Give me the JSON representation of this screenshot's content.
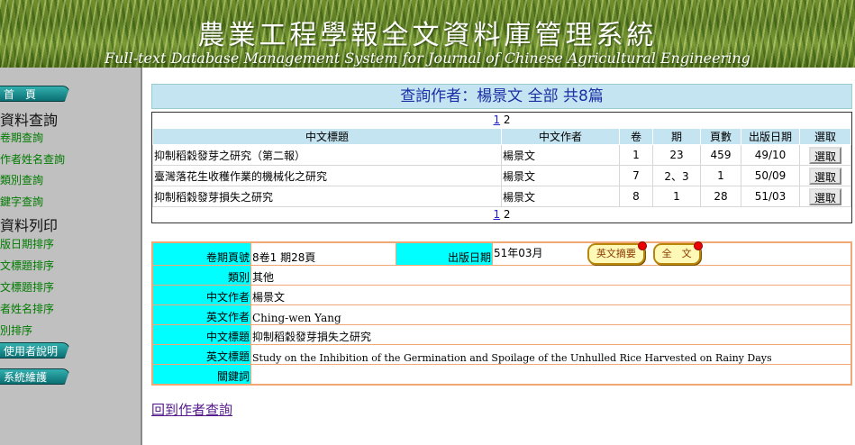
{
  "banner": {
    "cn_title": "農業工程學報全文資料庫管理系統",
    "en_title": "Full-text Database Management System for Journal of Chinese Agricultural Engineering"
  },
  "sidebar": {
    "home": "首　頁",
    "query_head": "資料查詢",
    "query_links": [
      "卷期查詢",
      "作者姓名查詢",
      "類別查詢",
      "鍵字查詢"
    ],
    "print_head": "資料列印",
    "print_links": [
      "版日期排序",
      "文標題排序",
      "文標題排序",
      "者姓名排序",
      "別排序"
    ],
    "user_guide": "使用者說明",
    "maintenance": "系統維護"
  },
  "result": {
    "title": "查詢作者：楊景文 全部 共8篇",
    "pages": [
      "1",
      "2"
    ],
    "columns": [
      "中文標題",
      "中文作者",
      "卷",
      "期",
      "頁數",
      "出版日期",
      "選取"
    ],
    "rows": [
      {
        "title": "抑制稻穀發芽之研究（第二報）",
        "author": "楊景文",
        "vol": "1",
        "issue": "23",
        "page": "459",
        "date": "49/10",
        "pick": "選取"
      },
      {
        "title": "臺灣落花生收穫作業的機械化之研究",
        "author": "楊景文",
        "vol": "7",
        "issue": "2、3",
        "page": "1",
        "date": "50/09",
        "pick": "選取"
      },
      {
        "title": "抑制稻穀發芽損失之研究",
        "author": "楊景文",
        "vol": "8",
        "issue": "1",
        "page": "28",
        "date": "51/03",
        "pick": "選取"
      }
    ]
  },
  "detail": {
    "vol_label": "卷期頁號",
    "vol_value": "8卷1 期28頁",
    "date_label": "出版日期",
    "date_value": "51年03月",
    "abstract_btn": "英文摘要",
    "fulltext_btn": "全　文",
    "category_label": "類別",
    "category_value": "其他",
    "cn_author_label": "中文作者",
    "cn_author_value": "楊景文",
    "en_author_label": "英文作者",
    "en_author_value": "Ching-wen Yang",
    "cn_title_label": "中文標題",
    "cn_title_value": "抑制稻穀發芽損失之研究",
    "en_title_label": "英文標題",
    "en_title_value": "Study on the Inhibition of the Germination and Spoilage of the Unhulled Rice Harvested on Rainy Days",
    "keywords_label": "關鍵詞",
    "keywords_value": ""
  },
  "back_link": "回到作者查詢"
}
